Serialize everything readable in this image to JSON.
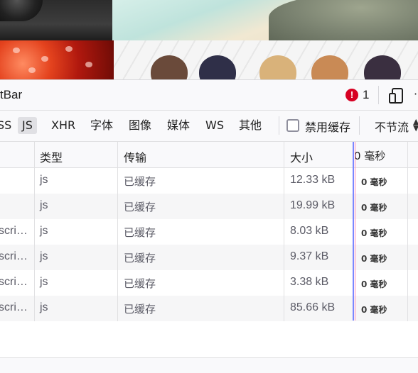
{
  "web_content": {
    "tiles": [
      "car-photo",
      "beach-photo",
      "strawberry-photo",
      "anime-banner"
    ]
  },
  "toolbar": {
    "title": "tBar",
    "error_count": "1",
    "error_icon": "!"
  },
  "filters": {
    "items": [
      {
        "label": "SS"
      },
      {
        "label": "JS",
        "active": true
      },
      {
        "label": "XHR"
      },
      {
        "label": "字体"
      },
      {
        "label": "图像"
      },
      {
        "label": "媒体"
      },
      {
        "label": "WS"
      },
      {
        "label": "其他"
      }
    ],
    "disable_cache_label": "禁用缓存",
    "throttle_label": "不节流"
  },
  "table": {
    "headers": {
      "type": "类型",
      "transfer": "传输",
      "size": "大小",
      "timing": "0 毫秒"
    },
    "rows": [
      {
        "file": "",
        "type": "js",
        "transfer": "已缓存",
        "size": "12.33 kB",
        "timing": "0 毫秒"
      },
      {
        "file": "",
        "type": "js",
        "transfer": "已缓存",
        "size": "19.99 kB",
        "timing": "0 毫秒"
      },
      {
        "file": "scri…",
        "type": "js",
        "transfer": "已缓存",
        "size": "8.03 kB",
        "timing": "0 毫秒"
      },
      {
        "file": "scri…",
        "type": "js",
        "transfer": "已缓存",
        "size": "9.37 kB",
        "timing": "0 毫秒"
      },
      {
        "file": "scri…",
        "type": "js",
        "transfer": "已缓存",
        "size": "3.38 kB",
        "timing": "0 毫秒"
      },
      {
        "file": "scri…",
        "type": "js",
        "transfer": "已缓存",
        "size": "85.66 kB",
        "timing": "0 毫秒"
      }
    ]
  }
}
